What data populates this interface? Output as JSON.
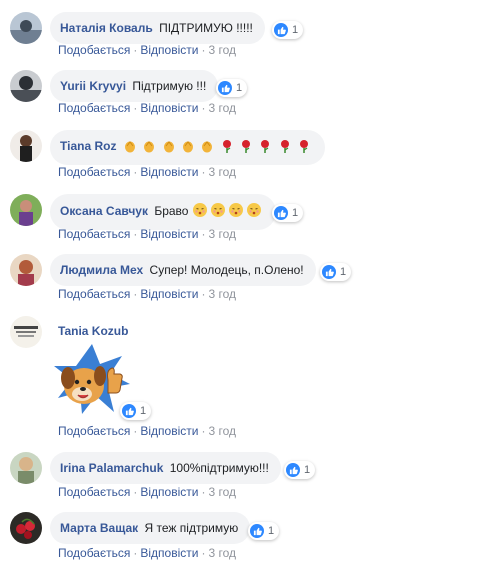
{
  "comments": [
    {
      "author": "Наталія Коваль",
      "text": "ПІДТРИМУЮ !!!!!",
      "reaction_count": "1",
      "like": "Подобається",
      "reply": "Відповісти",
      "time": "3 год"
    },
    {
      "author": "Yurii Kryvyi",
      "text": "Підтримую !!!",
      "reaction_count": "1",
      "like": "Подобається",
      "reply": "Відповісти",
      "time": "3 год"
    },
    {
      "author": "Tiana Roz",
      "text": "",
      "emojis": [
        "clap",
        "clap",
        "clap",
        "clap",
        "clap",
        "rose",
        "rose",
        "rose",
        "rose",
        "rose"
      ],
      "like": "Подобається",
      "reply": "Відповісти",
      "time": "3 год"
    },
    {
      "author": "Оксана Савчук",
      "text": "Браво",
      "emojis": [
        "kiss",
        "kiss",
        "kiss",
        "kiss"
      ],
      "reaction_count": "1",
      "like": "Подобається",
      "reply": "Відповісти",
      "time": "3 год"
    },
    {
      "author": "Людмила Мех",
      "text": "Супер! Молодець, п.Олено!",
      "reaction_count": "1",
      "like": "Подобається",
      "reply": "Відповісти",
      "time": "3 год"
    },
    {
      "author": "Tania Kozub",
      "text": "",
      "sticker": "dog-thumbs-up-sticker",
      "reaction_count": "1",
      "like": "Подобається",
      "reply": "Відповісти",
      "time": "3 год"
    },
    {
      "author": "Irina Palamarchuk",
      "text": "100%підтримую!!!",
      "reaction_count": "1",
      "like": "Подобається",
      "reply": "Відповісти",
      "time": "3 год"
    },
    {
      "author": "Марта Ващак",
      "text": "Я теж підтримую",
      "reaction_count": "1",
      "like": "Подобається",
      "reply": "Відповісти",
      "time": "3 год"
    }
  ],
  "separator": "·",
  "colors": {
    "author": "#385898",
    "bubble": "#f2f3f5",
    "like_badge": "#2d88ff",
    "meta": "#90949c"
  }
}
